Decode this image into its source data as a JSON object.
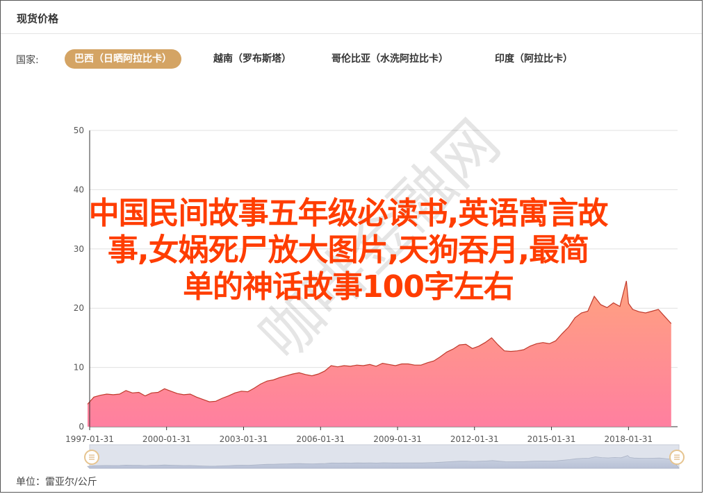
{
  "header": {
    "title": "现货价格"
  },
  "country_filter": {
    "label": "国家:",
    "tabs": [
      {
        "label": "巴西（日晒阿拉比卡）",
        "active": true
      },
      {
        "label": "越南（罗布斯塔）",
        "active": false
      },
      {
        "label": "哥伦比亚（水洗阿拉比卡）",
        "active": false
      },
      {
        "label": "印度（阿拉比卡）",
        "active": false
      }
    ]
  },
  "unit_label": "单位：雷亚尔/公斤",
  "overlay": {
    "line1": "中国民间故事五年级必读书,英语寓言故",
    "line2": "事,女娲死尸放大图片,天狗吞月,最简",
    "line3": "单的神话故事100字左右"
  },
  "watermark": "咖啡金融网",
  "colors": {
    "accent": "#d4a464",
    "area_top": "#ffa27f",
    "area_bottom": "#ff7fa0",
    "line": "#c0392b",
    "overlay_text": "#ff3d00"
  },
  "chart_data": {
    "type": "area",
    "x_ticks": [
      "1997-01-31",
      "2000-01-31",
      "2003-01-31",
      "2006-01-31",
      "2009-01-31",
      "2012-01-31",
      "2015-01-31",
      "2018-01-31"
    ],
    "ylim": [
      0,
      50
    ],
    "y_ticks": [
      0,
      10,
      20,
      30,
      40,
      50
    ],
    "grid": true,
    "x": [
      "1997-01",
      "1997-04",
      "1997-07",
      "1997-10",
      "1998-01",
      "1998-04",
      "1998-07",
      "1998-10",
      "1999-01",
      "1999-04",
      "1999-07",
      "1999-10",
      "2000-01",
      "2000-04",
      "2000-07",
      "2000-10",
      "2001-01",
      "2001-04",
      "2001-07",
      "2001-10",
      "2002-01",
      "2002-04",
      "2002-07",
      "2002-10",
      "2003-01",
      "2003-04",
      "2003-07",
      "2003-10",
      "2004-01",
      "2004-04",
      "2004-07",
      "2004-10",
      "2005-01",
      "2005-04",
      "2005-07",
      "2005-10",
      "2006-01",
      "2006-04",
      "2006-07",
      "2006-10",
      "2007-01",
      "2007-04",
      "2007-07",
      "2007-10",
      "2008-01",
      "2008-04",
      "2008-07",
      "2008-10",
      "2009-01",
      "2009-04",
      "2009-07",
      "2009-10",
      "2010-01",
      "2010-04",
      "2010-07",
      "2010-10",
      "2011-01",
      "2011-04",
      "2011-07",
      "2011-10",
      "2012-01",
      "2012-04",
      "2012-07",
      "2012-10",
      "2013-01",
      "2013-04",
      "2013-07",
      "2013-10",
      "2014-01",
      "2014-04",
      "2014-07",
      "2014-10",
      "2015-01",
      "2015-04",
      "2015-07",
      "2015-10",
      "2016-01",
      "2016-04",
      "2016-07",
      "2016-10",
      "2017-01",
      "2017-04",
      "2017-07",
      "2017-10",
      "2018-01",
      "2018-02",
      "2018-04",
      "2018-07",
      "2018-10",
      "2019-01",
      "2019-04",
      "2019-07",
      "2019-10"
    ],
    "series": [
      {
        "values": [
          3.8,
          5.0,
          5.3,
          5.5,
          5.4,
          5.5,
          6.1,
          5.7,
          5.8,
          5.2,
          5.7,
          5.8,
          6.4,
          6.0,
          5.6,
          5.4,
          5.5,
          5.0,
          4.6,
          4.2,
          4.3,
          4.8,
          5.2,
          5.7,
          6.0,
          5.9,
          6.5,
          7.2,
          7.7,
          7.9,
          8.3,
          8.6,
          8.9,
          9.1,
          8.8,
          8.6,
          8.9,
          9.4,
          10.3,
          10.1,
          10.3,
          10.2,
          10.4,
          10.3,
          10.5,
          10.2,
          10.7,
          10.5,
          10.3,
          10.6,
          10.6,
          10.4,
          10.4,
          10.8,
          11.1,
          11.8,
          12.6,
          13.1,
          13.8,
          13.9,
          13.2,
          13.6,
          14.2,
          15.0,
          13.8,
          12.8,
          12.7,
          12.8,
          13.0,
          13.6,
          14.0,
          14.2,
          14.0,
          14.5,
          15.7,
          16.8,
          18.4,
          19.2,
          19.5,
          22.0,
          20.6,
          20.1,
          20.9,
          20.3,
          24.6,
          20.8,
          19.8,
          19.4,
          19.2,
          19.5,
          19.8,
          18.6,
          17.4
        ]
      }
    ]
  }
}
